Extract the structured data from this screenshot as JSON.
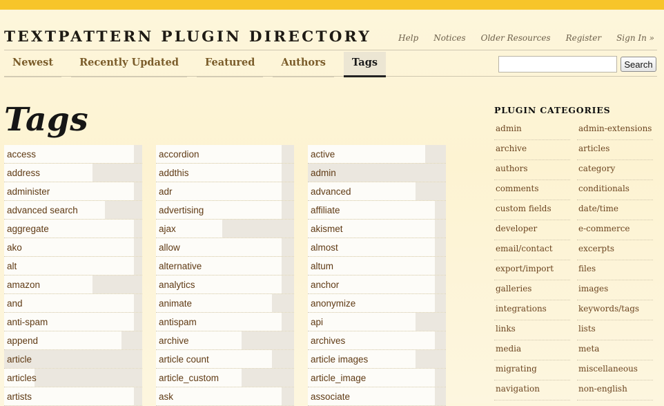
{
  "site": {
    "title": "TEXTPATTERN PLUGIN DIRECTORY",
    "accent": "#f7c52a"
  },
  "util_nav": [
    "Help",
    "Notices",
    "Older Resources",
    "Register",
    "Sign In »"
  ],
  "tabs": [
    {
      "label": "Newest",
      "active": false
    },
    {
      "label": "Recently Updated",
      "active": false
    },
    {
      "label": "Featured",
      "active": false
    },
    {
      "label": "Authors",
      "active": false
    },
    {
      "label": "Tags",
      "active": true
    }
  ],
  "search": {
    "value": "",
    "button_label": "Search"
  },
  "page_title": "Tags",
  "tag_columns": [
    [
      {
        "label": "access",
        "level": 0.94
      },
      {
        "label": "address",
        "level": 0.64
      },
      {
        "label": "administer",
        "level": 0.94
      },
      {
        "label": "advanced search",
        "level": 0.73
      },
      {
        "label": "aggregate",
        "level": 0.94
      },
      {
        "label": "ako",
        "level": 0.94
      },
      {
        "label": "alt",
        "level": 0.94
      },
      {
        "label": "amazon",
        "level": 0.64
      },
      {
        "label": "and",
        "level": 0.94
      },
      {
        "label": "anti-spam",
        "level": 0.94
      },
      {
        "label": "append",
        "level": 0.85
      },
      {
        "label": "article",
        "level": 0.0
      },
      {
        "label": "articles",
        "level": 0.22
      },
      {
        "label": "artists",
        "level": 0.94
      }
    ],
    [
      {
        "label": "accordion",
        "level": 0.91
      },
      {
        "label": "addthis",
        "level": 0.91
      },
      {
        "label": "adr",
        "level": 0.91
      },
      {
        "label": "advertising",
        "level": 0.91
      },
      {
        "label": "ajax",
        "level": 0.48
      },
      {
        "label": "allow",
        "level": 0.91
      },
      {
        "label": "alternative",
        "level": 0.91
      },
      {
        "label": "analytics",
        "level": 0.91
      },
      {
        "label": "animate",
        "level": 0.84
      },
      {
        "label": "antispam",
        "level": 0.91
      },
      {
        "label": "archive",
        "level": 0.62
      },
      {
        "label": "article count",
        "level": 0.84
      },
      {
        "label": "article_custom",
        "level": 0.62
      },
      {
        "label": "ask",
        "level": 0.91
      }
    ],
    [
      {
        "label": "active",
        "level": 0.85
      },
      {
        "label": "admin",
        "level": 0.0
      },
      {
        "label": "advanced",
        "level": 0.78
      },
      {
        "label": "affiliate",
        "level": 0.92
      },
      {
        "label": "akismet",
        "level": 0.92
      },
      {
        "label": "almost",
        "level": 0.92
      },
      {
        "label": "altum",
        "level": 0.92
      },
      {
        "label": "anchor",
        "level": 0.92
      },
      {
        "label": "anonymize",
        "level": 0.92
      },
      {
        "label": "api",
        "level": 0.78
      },
      {
        "label": "archives",
        "level": 0.92
      },
      {
        "label": "article images",
        "level": 0.78
      },
      {
        "label": "article_image",
        "level": 0.92
      },
      {
        "label": "associate",
        "level": 0.92
      }
    ]
  ],
  "sidebar": {
    "heading": "PLUGIN CATEGORIES",
    "categories": [
      "admin",
      "admin-extensions",
      "archive",
      "articles",
      "authors",
      "category",
      "comments",
      "conditionals",
      "custom fields",
      "date/time",
      "developer",
      "e-commerce",
      "email/contact",
      "excerpts",
      "export/import",
      "files",
      "galleries",
      "images",
      "integrations",
      "keywords/tags",
      "links",
      "lists",
      "media",
      "meta",
      "migrating",
      "miscellaneous",
      "navigation",
      "non-english"
    ]
  }
}
